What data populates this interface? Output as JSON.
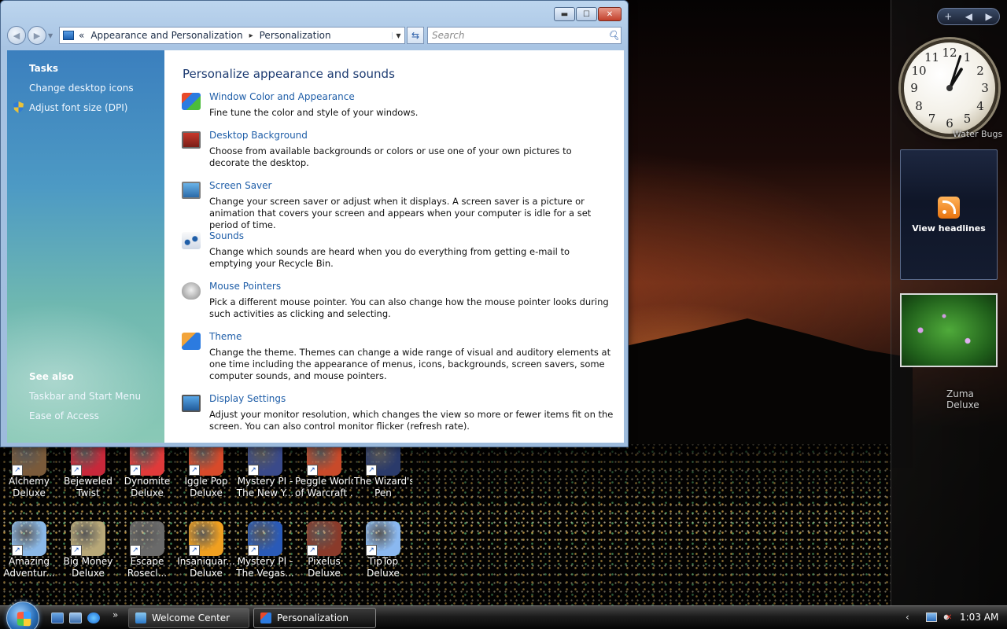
{
  "window": {
    "caption_buttons": {
      "minimize": "▬",
      "maximize": "☐",
      "close": "✕"
    },
    "address": {
      "overflow": "«",
      "crumbs": [
        "Appearance and Personalization",
        "Personalization"
      ],
      "separator": "▸",
      "dropdown": "▼"
    },
    "refresh_glyph": "⇆",
    "search_placeholder": "Search",
    "nav": {
      "back": "◀",
      "forward": "▶",
      "dropdown": "▼"
    }
  },
  "left_pane": {
    "tasks_heading": "Tasks",
    "tasks": [
      "Change desktop icons",
      "Adjust font size (DPI)"
    ],
    "see_also_heading": "See also",
    "see_also": [
      "Taskbar and Start Menu",
      "Ease of Access"
    ]
  },
  "content": {
    "heading": "Personalize appearance and sounds",
    "items": [
      {
        "icon": "window-color-icon",
        "title": "Window Color and Appearance",
        "desc": "Fine tune the color and style of your windows."
      },
      {
        "icon": "desktop-background-icon",
        "title": "Desktop Background",
        "desc": "Choose from available backgrounds or colors or use one of your own pictures to decorate the desktop."
      },
      {
        "icon": "screen-saver-icon",
        "title": "Screen Saver",
        "desc": "Change your screen saver or adjust when it displays. A screen saver is a picture or animation that covers your screen and appears when your computer is idle for a set period of time."
      },
      {
        "icon": "sounds-icon",
        "title": "Sounds",
        "desc": "Change which sounds are heard when you do everything from getting e-mail to emptying your Recycle Bin."
      },
      {
        "icon": "mouse-pointers-icon",
        "title": "Mouse Pointers",
        "desc": "Pick a different mouse pointer. You can also change how the mouse pointer looks during such activities as clicking and selecting."
      },
      {
        "icon": "theme-icon",
        "title": "Theme",
        "desc": "Change the theme. Themes can change a wide range of visual and auditory elements at one time including the appearance of menus, icons, backgrounds, screen savers, some computer sounds, and mouse pointers."
      },
      {
        "icon": "display-settings-icon",
        "title": "Display Settings",
        "desc": "Adjust your monitor resolution, which changes the view so more or fewer items fit on the screen. You can also control monitor flicker (refresh rate)."
      }
    ]
  },
  "desktop_icons": [
    {
      "label1": "Alchemy",
      "label2": "Deluxe",
      "color": "#7a5a3a"
    },
    {
      "label1": "Bejeweled",
      "label2": "Twist",
      "color": "#c8283a"
    },
    {
      "label1": "Dynomite",
      "label2": "Deluxe",
      "color": "#e03a3a"
    },
    {
      "label1": "Iggle Pop",
      "label2": "Deluxe",
      "color": "#d84a2a"
    },
    {
      "label1": "Mystery PI -",
      "label2": "The New Y...",
      "color": "#3a4a8a"
    },
    {
      "label1": "Peggle World",
      "label2": "of Warcraft ...",
      "color": "#c84a2a"
    },
    {
      "label1": "The Wizard's",
      "label2": "Pen",
      "color": "#2a3a6a"
    },
    {
      "label1": "Amazing",
      "label2": "Adventur...",
      "color": "#8ab8e8"
    },
    {
      "label1": "Big Money",
      "label2": "Deluxe",
      "color": "#b8a878"
    },
    {
      "label1": "Escape",
      "label2": "Rosecl...",
      "color": "#6a6a6a"
    },
    {
      "label1": "Insaniquar...",
      "label2": "Deluxe",
      "color": "#f0a020"
    },
    {
      "label1": "Mystery PI -",
      "label2": "The Vegas...",
      "color": "#2a5ab8"
    },
    {
      "label1": "Pixelus",
      "label2": "Deluxe",
      "color": "#8a3a2a"
    },
    {
      "label1": "TipTop",
      "label2": "Deluxe",
      "color": "#8ab8f0"
    }
  ],
  "gadgets": {
    "controls": {
      "add": "+",
      "prev": "◀",
      "next": "▶"
    },
    "clock_numbers": [
      "12",
      "1",
      "2",
      "3",
      "4",
      "5",
      "6",
      "7",
      "8",
      "9",
      "10",
      "11"
    ],
    "clock_label": "Water Bugs",
    "feed": "View headlines",
    "zuma_label": "Zuma Deluxe"
  },
  "taskbar": {
    "quick_launch_more": "»",
    "tasks": [
      {
        "label": "Welcome Center",
        "active": false
      },
      {
        "label": "Personalization",
        "active": true
      }
    ],
    "tray_arrow": "‹",
    "time": "1:03 AM"
  }
}
